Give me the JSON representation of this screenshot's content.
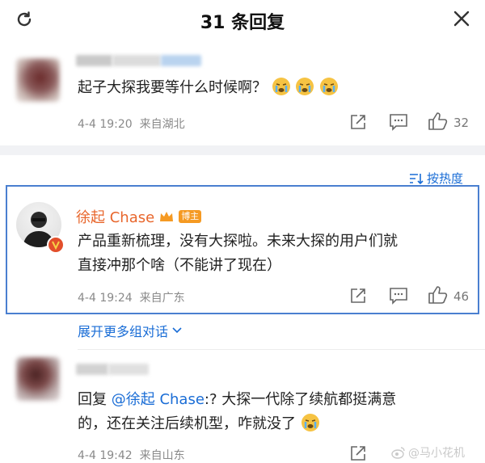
{
  "header": {
    "title": "31 条回复"
  },
  "comment1": {
    "text": "起子大探我要等什么时候啊？",
    "emojis": [
      "crying-emoji",
      "crying-emoji",
      "crying-emoji"
    ],
    "time": "4-4 19:20",
    "location": "来自湖北",
    "likes": "32"
  },
  "sort": {
    "label": "按热度"
  },
  "reply_main": {
    "author": "徐起 Chase",
    "badge": "博主",
    "text_line1": "产品重新梳理，没有大探啦。未来大探的用户们就",
    "text_line2": "直接冲那个啥（不能讲了现在）",
    "time": "4-4 19:24",
    "location": "来自广东",
    "likes": "46"
  },
  "expand": {
    "label": "展开更多组对话"
  },
  "comment3": {
    "prefix": "回复 ",
    "mention": "@徐起 Chase",
    "text_line1": ":? 大探一代除了续航都挺满意",
    "text_line2": "的，还在关注后续机型，咋就没了",
    "time": "4-4 19:42",
    "location": "来自山东",
    "watermark": "@马小花机"
  },
  "colors": {
    "accent": "#1a6dd6",
    "highlight": "#4a7fd0",
    "author": "#e8662c",
    "badge": "#f59a23"
  }
}
